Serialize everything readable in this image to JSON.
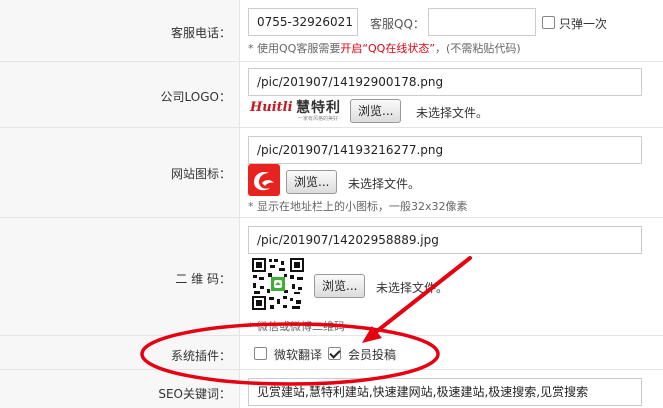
{
  "service_phone": {
    "label": "客服电话：",
    "value": "0755-32926021",
    "qq_label": "客服QQ：",
    "qq_value": "",
    "once_label": "只弹一次",
    "hint_prefix": "* 使用QQ客服需要",
    "hint_red": "开启“QQ在线状态”",
    "hint_suffix": "，(不需粘贴代码)"
  },
  "company_logo": {
    "label": "公司LOGO：",
    "path": "/pic/201907/14192900178.png",
    "logo_text": "慧特利",
    "logo_sub": "一家有风格的美好",
    "logo_script": "Huitli",
    "browse_label": "浏览...",
    "no_file": "未选择文件。"
  },
  "favicon": {
    "label": "网站图标：",
    "path": "/pic/201907/14193216277.png",
    "browse_label": "浏览...",
    "no_file": "未选择文件。",
    "hint": "* 显示在地址栏上的小图标，一般32x32像素"
  },
  "qrcode": {
    "label": "二 维 码：",
    "path": "/pic/201907/14202958889.jpg",
    "browse_label": "浏览...",
    "no_file": "未选择文件。",
    "hint": "* 微信或微博二维码"
  },
  "plugins": {
    "label": "系统插件：",
    "items": [
      {
        "label": "微软翻译",
        "checked": false
      },
      {
        "label": "会员投稿",
        "checked": true
      }
    ]
  },
  "seo_keywords": {
    "label": "SEO关键词：",
    "value": "见赏建站,慧特利建站,快速建网站,极速建站,极速搜索,见赏搜索"
  },
  "colors": {
    "annotation_red": "#e60012",
    "label_bg": "#f7f7f7",
    "border": "#e4e4e4"
  }
}
